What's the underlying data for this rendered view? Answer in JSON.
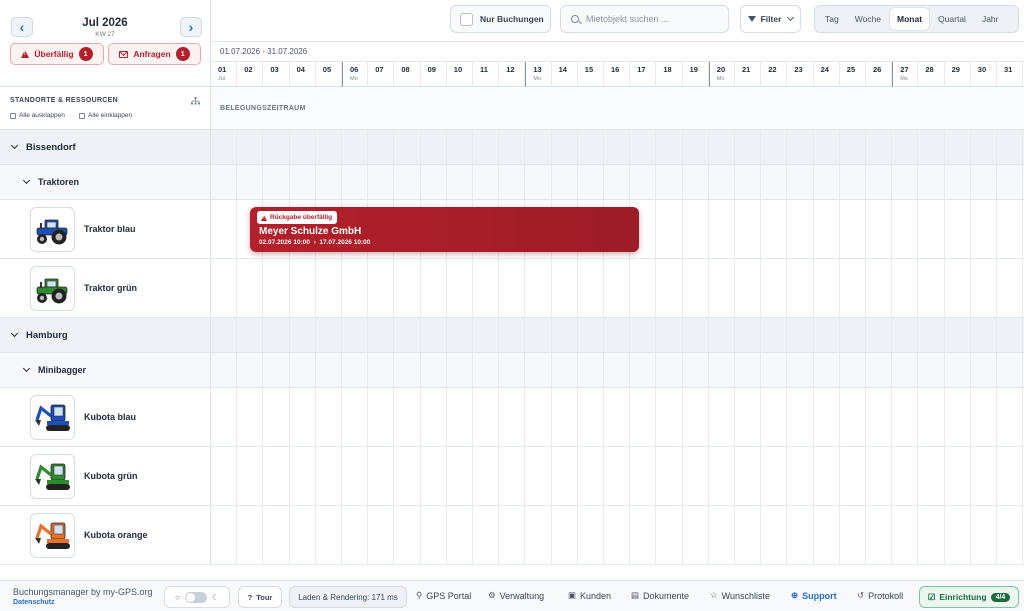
{
  "header": {
    "month_title": "Jul 2026",
    "week_label": "KW 27",
    "prev_icon": "chevron-left-icon",
    "next_icon": "chevron-right-icon",
    "overdue_label": "Überfällig",
    "overdue_count": "1",
    "requests_label": "Anfragen",
    "requests_count": "1"
  },
  "toolbar": {
    "only_bookings_label": "Nur Buchungen",
    "search_placeholder": "Mietobjekt suchen ...",
    "filter_label": "Filter",
    "views": [
      "Tag",
      "Woche",
      "Monat",
      "Quartal",
      "Jahr"
    ],
    "active_view": "Monat"
  },
  "calendar": {
    "range_label": "01.07.2026 - 31.07.2026",
    "days": [
      {
        "num": "01",
        "sub": "Jul",
        "monday": false
      },
      {
        "num": "02",
        "sub": "",
        "monday": false
      },
      {
        "num": "03",
        "sub": "",
        "monday": false
      },
      {
        "num": "04",
        "sub": "",
        "monday": false
      },
      {
        "num": "05",
        "sub": "",
        "monday": false
      },
      {
        "num": "06",
        "sub": "Mo",
        "monday": true
      },
      {
        "num": "07",
        "sub": "",
        "monday": false
      },
      {
        "num": "08",
        "sub": "",
        "monday": false
      },
      {
        "num": "09",
        "sub": "",
        "monday": false
      },
      {
        "num": "10",
        "sub": "",
        "monday": false
      },
      {
        "num": "11",
        "sub": "",
        "monday": false
      },
      {
        "num": "12",
        "sub": "",
        "monday": false
      },
      {
        "num": "13",
        "sub": "Mo",
        "monday": true
      },
      {
        "num": "14",
        "sub": "",
        "monday": false
      },
      {
        "num": "15",
        "sub": "",
        "monday": false
      },
      {
        "num": "16",
        "sub": "",
        "monday": false
      },
      {
        "num": "17",
        "sub": "",
        "monday": false
      },
      {
        "num": "18",
        "sub": "",
        "monday": false
      },
      {
        "num": "19",
        "sub": "",
        "monday": false
      },
      {
        "num": "20",
        "sub": "Mo",
        "monday": true
      },
      {
        "num": "21",
        "sub": "",
        "monday": false
      },
      {
        "num": "22",
        "sub": "",
        "monday": false
      },
      {
        "num": "23",
        "sub": "",
        "monday": false
      },
      {
        "num": "24",
        "sub": "",
        "monday": false
      },
      {
        "num": "25",
        "sub": "",
        "monday": false
      },
      {
        "num": "26",
        "sub": "",
        "monday": false
      },
      {
        "num": "27",
        "sub": "Mo",
        "monday": true
      },
      {
        "num": "28",
        "sub": "",
        "monday": false
      },
      {
        "num": "29",
        "sub": "",
        "monday": false
      },
      {
        "num": "30",
        "sub": "",
        "monday": false
      },
      {
        "num": "31",
        "sub": "",
        "monday": false
      }
    ],
    "occupancy_label": "BELEGUNGSZEITRAUM"
  },
  "sidebar": {
    "title": "STANDORTE & RESSOURCEN",
    "expand_all": "Alle ausklappen",
    "collapse_all": "Alle einklappen"
  },
  "rows": [
    {
      "type": "group",
      "label": "Bissendorf"
    },
    {
      "type": "sub",
      "label": "Traktoren"
    },
    {
      "type": "res",
      "label": "Traktor blau",
      "icon": "tractor-icon",
      "color": "#1d4fb8"
    },
    {
      "type": "res",
      "label": "Traktor grün",
      "icon": "tractor-icon",
      "color": "#2e8b2e"
    },
    {
      "type": "group",
      "label": "Hamburg"
    },
    {
      "type": "sub",
      "label": "Minibagger"
    },
    {
      "type": "res",
      "label": "Kubota blau",
      "icon": "excavator-icon",
      "color": "#1d4fb8"
    },
    {
      "type": "res",
      "label": "Kubota grün",
      "icon": "excavator-icon",
      "color": "#2e8b2e"
    },
    {
      "type": "res",
      "label": "Kubota orange",
      "icon": "excavator-icon",
      "color": "#e8702a"
    }
  ],
  "booking": {
    "badge": "Rückgabe überfällig",
    "customer": "Meyer Schulze GmbH",
    "start": "02.07.2026 10:00",
    "arrow": "›",
    "end": "17.07.2026 10:00",
    "color": "#b3202b"
  },
  "footer": {
    "brand": "Buchungsmanager by my-GPS.org",
    "privacy": "Datenschutz",
    "tour": "Tour",
    "perf": "Laden & Rendering: 171 ms",
    "links": [
      {
        "label": "GPS Portal",
        "icon": "map-pin-icon",
        "glyph": "⚲"
      },
      {
        "label": "Verwaltung",
        "icon": "gears-icon",
        "glyph": "⚙"
      },
      {
        "label": "Kunden",
        "icon": "contacts-icon",
        "glyph": "▣"
      },
      {
        "label": "Dokumente",
        "icon": "document-icon",
        "glyph": "▤"
      },
      {
        "label": "Wunschliste",
        "icon": "star-icon",
        "glyph": "☆"
      },
      {
        "label": "Support",
        "icon": "lifebuoy-icon",
        "glyph": "⊕"
      },
      {
        "label": "Protokoll",
        "icon": "history-icon",
        "glyph": "↺"
      }
    ],
    "setup_label": "Einrichtung",
    "setup_badge": "4/4"
  }
}
